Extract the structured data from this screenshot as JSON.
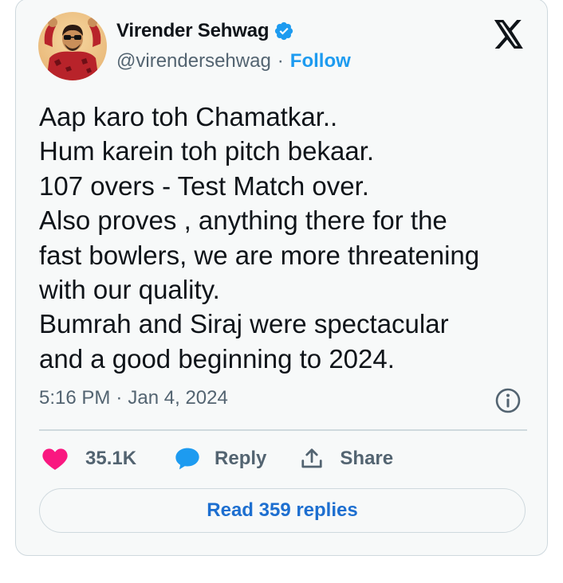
{
  "author": {
    "name": "Virender Sehwag",
    "verified": true,
    "handle": "@virendersehwag",
    "separator": "·",
    "follow_label": "Follow"
  },
  "platform_icon": "x-logo-icon",
  "tweet": {
    "lines": [
      "Aap karo toh Chamatkar..",
      "Hum karein toh pitch bekaar.",
      "107 overs - Test Match over.",
      "Also proves , anything there for the",
      "fast bowlers, we are more threatening",
      "with our quality.",
      "Bumrah and Siraj were spectacular",
      "and a good beginning to 2024."
    ],
    "time": "5:16 PM",
    "separator": "·",
    "date": "Jan 4, 2024"
  },
  "actions": {
    "like_count": "35.1K",
    "reply_label": "Reply",
    "share_label": "Share"
  },
  "read_replies_label": "Read 359 replies",
  "colors": {
    "link": "#1d9bf0",
    "like": "#f91880",
    "reply_icon": "#1d9bf0",
    "text": "#0f1419",
    "muted": "#536471",
    "border": "#cfd9de",
    "card_bg": "#f7f9f9"
  }
}
